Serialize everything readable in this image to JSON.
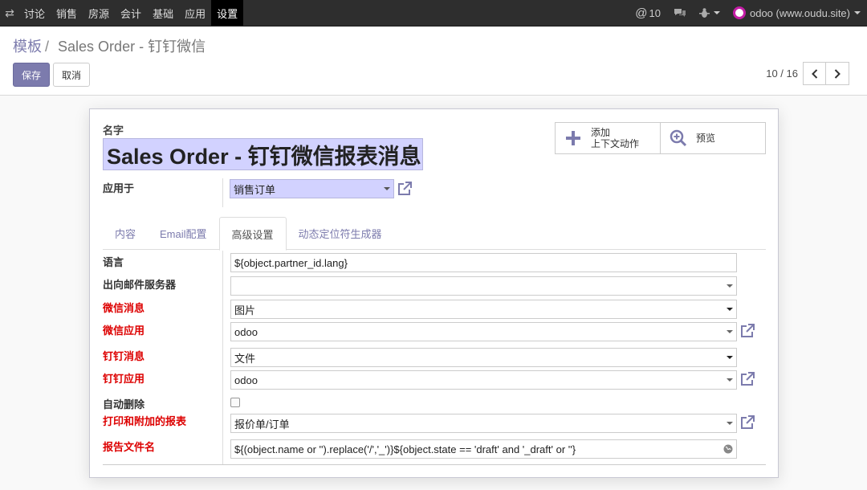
{
  "navbar": {
    "menu": [
      {
        "label": "讨论"
      },
      {
        "label": "销售"
      },
      {
        "label": "房源"
      },
      {
        "label": "会计"
      },
      {
        "label": "基础"
      },
      {
        "label": "应用"
      },
      {
        "label": "设置",
        "active": true
      }
    ],
    "mentions_count": "10",
    "user_label": "odoo (www.oudu.site)"
  },
  "breadcrumb": {
    "parent": "模板",
    "current": "Sales Order - 钉钉微信"
  },
  "buttons": {
    "save": "保存",
    "cancel": "取消"
  },
  "pager": {
    "value": "10 / 16"
  },
  "form": {
    "name_label": "名字",
    "name_value": "Sales Order - 钉钉微信报表消息",
    "button_box": {
      "add_context": [
        "添加",
        "上下文动作"
      ],
      "preview": "预览"
    },
    "apply_to": {
      "label": "应用于",
      "value": "销售订单"
    },
    "tabs": [
      {
        "label": "内容"
      },
      {
        "label": "Email配置"
      },
      {
        "label": "高级设置",
        "active": true
      },
      {
        "label": "动态定位符生成器"
      }
    ],
    "rows": {
      "lang": {
        "label": "语言",
        "value": "${object.partner_id.lang}"
      },
      "mail_server": {
        "label": "出向邮件服务器",
        "value": ""
      },
      "wechat_msg": {
        "label": "微信消息",
        "value": "图片"
      },
      "wechat_app": {
        "label": "微信应用",
        "value": "odoo"
      },
      "dingtalk_msg": {
        "label": "钉钉消息",
        "value": "文件"
      },
      "dingtalk_app": {
        "label": "钉钉应用",
        "value": "odoo"
      },
      "auto_delete": {
        "label": "自动删除",
        "checked": false
      },
      "report": {
        "label": "打印和附加的报表",
        "value": "报价单/订单"
      },
      "report_name": {
        "label": "报告文件名",
        "value": "${(object.name or '').replace('/','_')}${object.state == 'draft' and '_draft' or ''}"
      }
    }
  },
  "colors": {
    "brand": "#7c7bad",
    "required_bg": "#d2d2ff",
    "required_label": "#dd0000",
    "navbar_bg": "#2e2e2e"
  }
}
